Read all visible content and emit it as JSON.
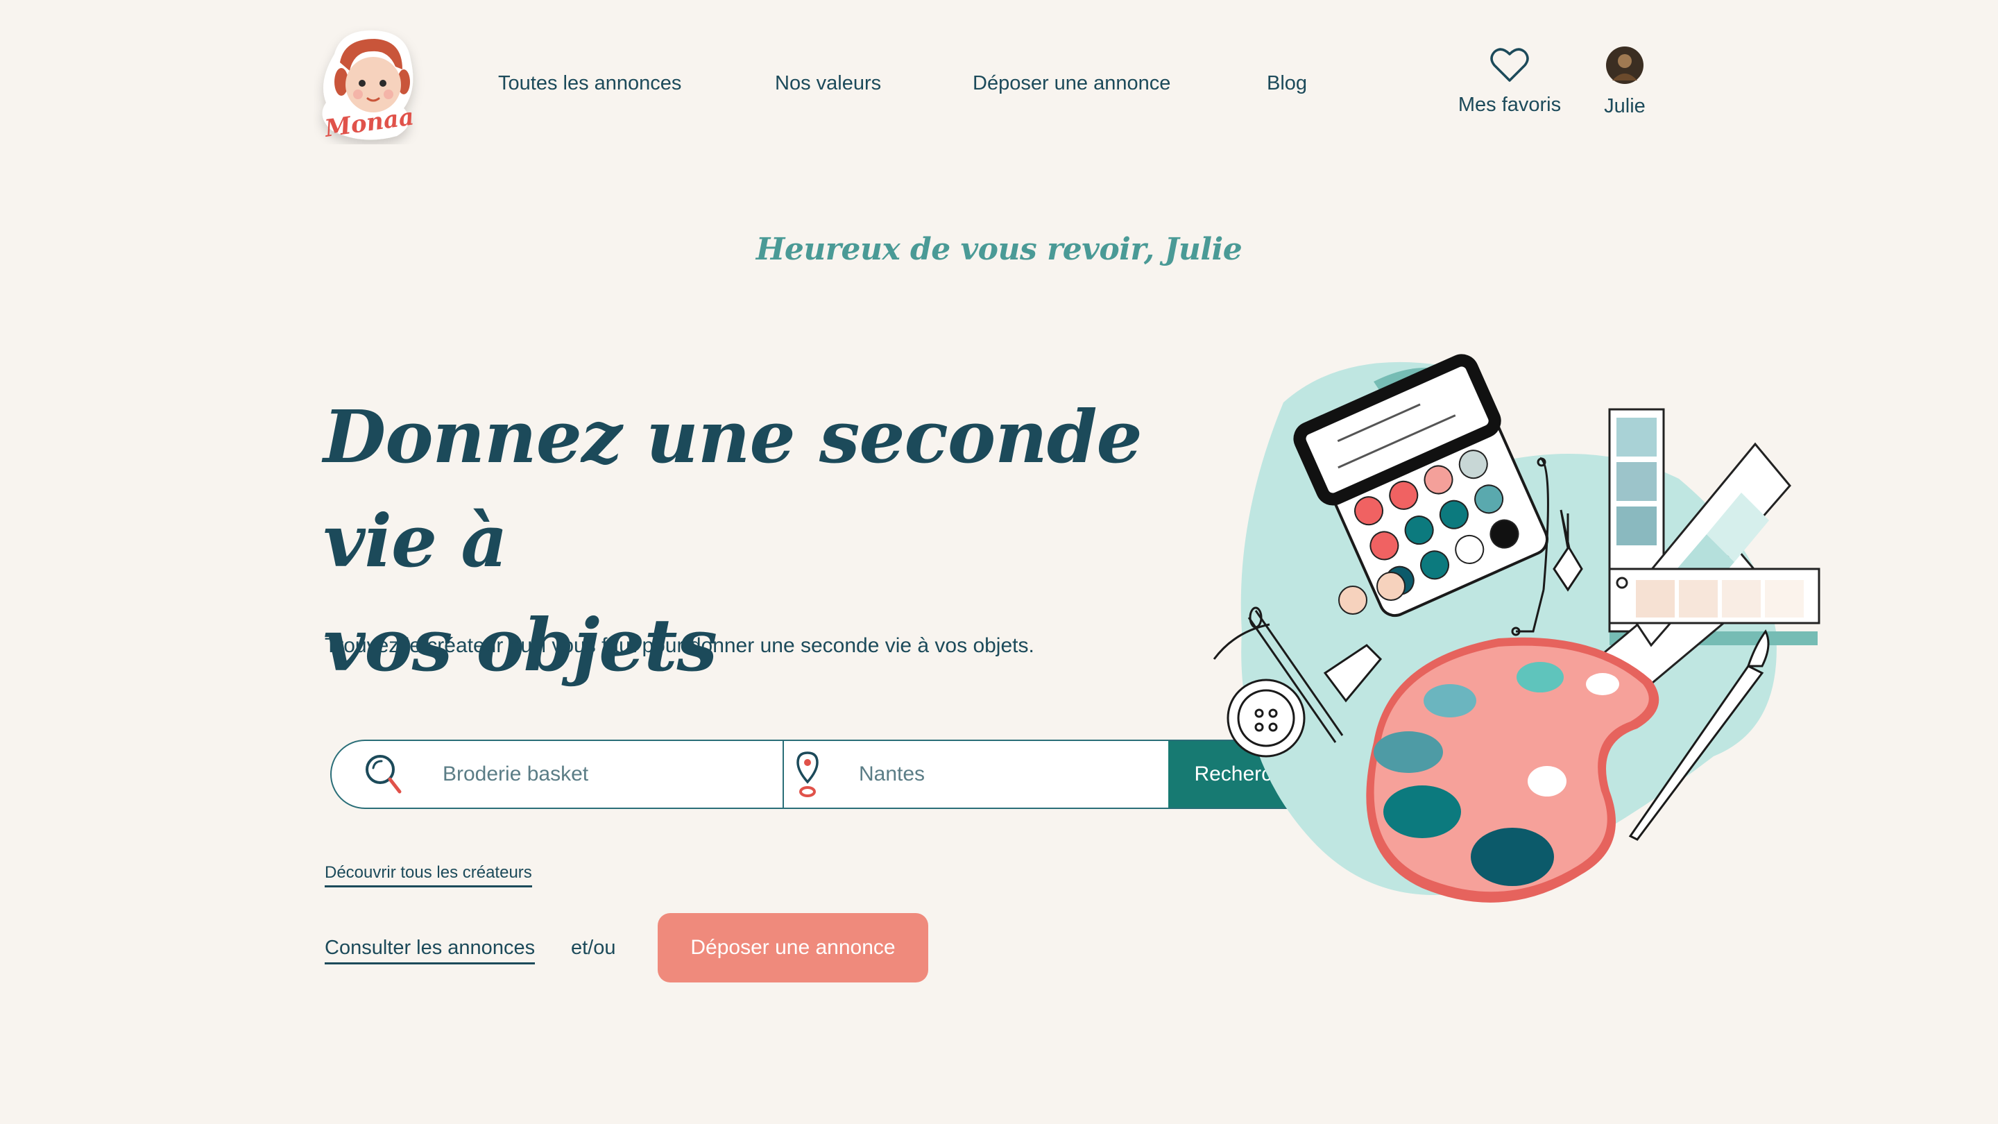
{
  "header": {
    "logo_text": "Monaa",
    "nav": [
      {
        "label": "Toutes les annonces"
      },
      {
        "label": "Nos valeurs"
      },
      {
        "label": "Déposer une annonce"
      },
      {
        "label": "Blog"
      }
    ],
    "favorites_label": "Mes favoris",
    "user_name": "Julie"
  },
  "greeting": "Heureux de vous revoir, Julie",
  "hero": {
    "title_line1": "Donnez une seconde vie à",
    "title_line2": "vos objets",
    "subtitle": "Trouvez le créateur qu’il vous faut pour donner une seconde vie à vos objets."
  },
  "search": {
    "query_placeholder": "Broderie basket",
    "location_placeholder": "Nantes",
    "button_label": "Rechercher"
  },
  "links": {
    "discover_creators": "Découvrir tous les créateurs",
    "browse_ads": "Consulter les annonces",
    "and_or": "et/ou",
    "post_ad": "Déposer une annonce"
  },
  "colors": {
    "background": "#f8f4ef",
    "primary_text": "#1c4a5a",
    "accent_teal": "#177a72",
    "accent_coral": "#ef8a7c",
    "greeting": "#4a9a96"
  }
}
